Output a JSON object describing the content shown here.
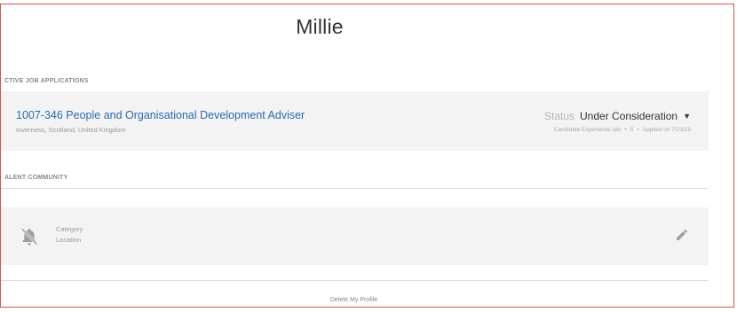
{
  "profile": {
    "name": "Millie"
  },
  "applications": {
    "section_label": "CTIVE JOB APPLICATIONS",
    "items": [
      {
        "title": "1007-346 People and Organisational Development Adviser",
        "location": "Inverness, Scotland, United Kingdom",
        "status_label": "Status",
        "status_value": "Under Consideration",
        "source": "Candidate Experience site",
        "number": "5",
        "applied": "Applied on 7/23/19"
      }
    ]
  },
  "talent_community": {
    "section_label": "ALENT COMMUNITY",
    "category_label": "Category",
    "location_label": "Location",
    "alert_icon": "bell-off-icon",
    "edit_icon": "pencil-icon"
  },
  "footer": {
    "delete_label": "Delete My Profile"
  },
  "colors": {
    "link": "#2a6bb0",
    "card_bg": "#f3f3f3",
    "frame_border": "#d9534f"
  }
}
